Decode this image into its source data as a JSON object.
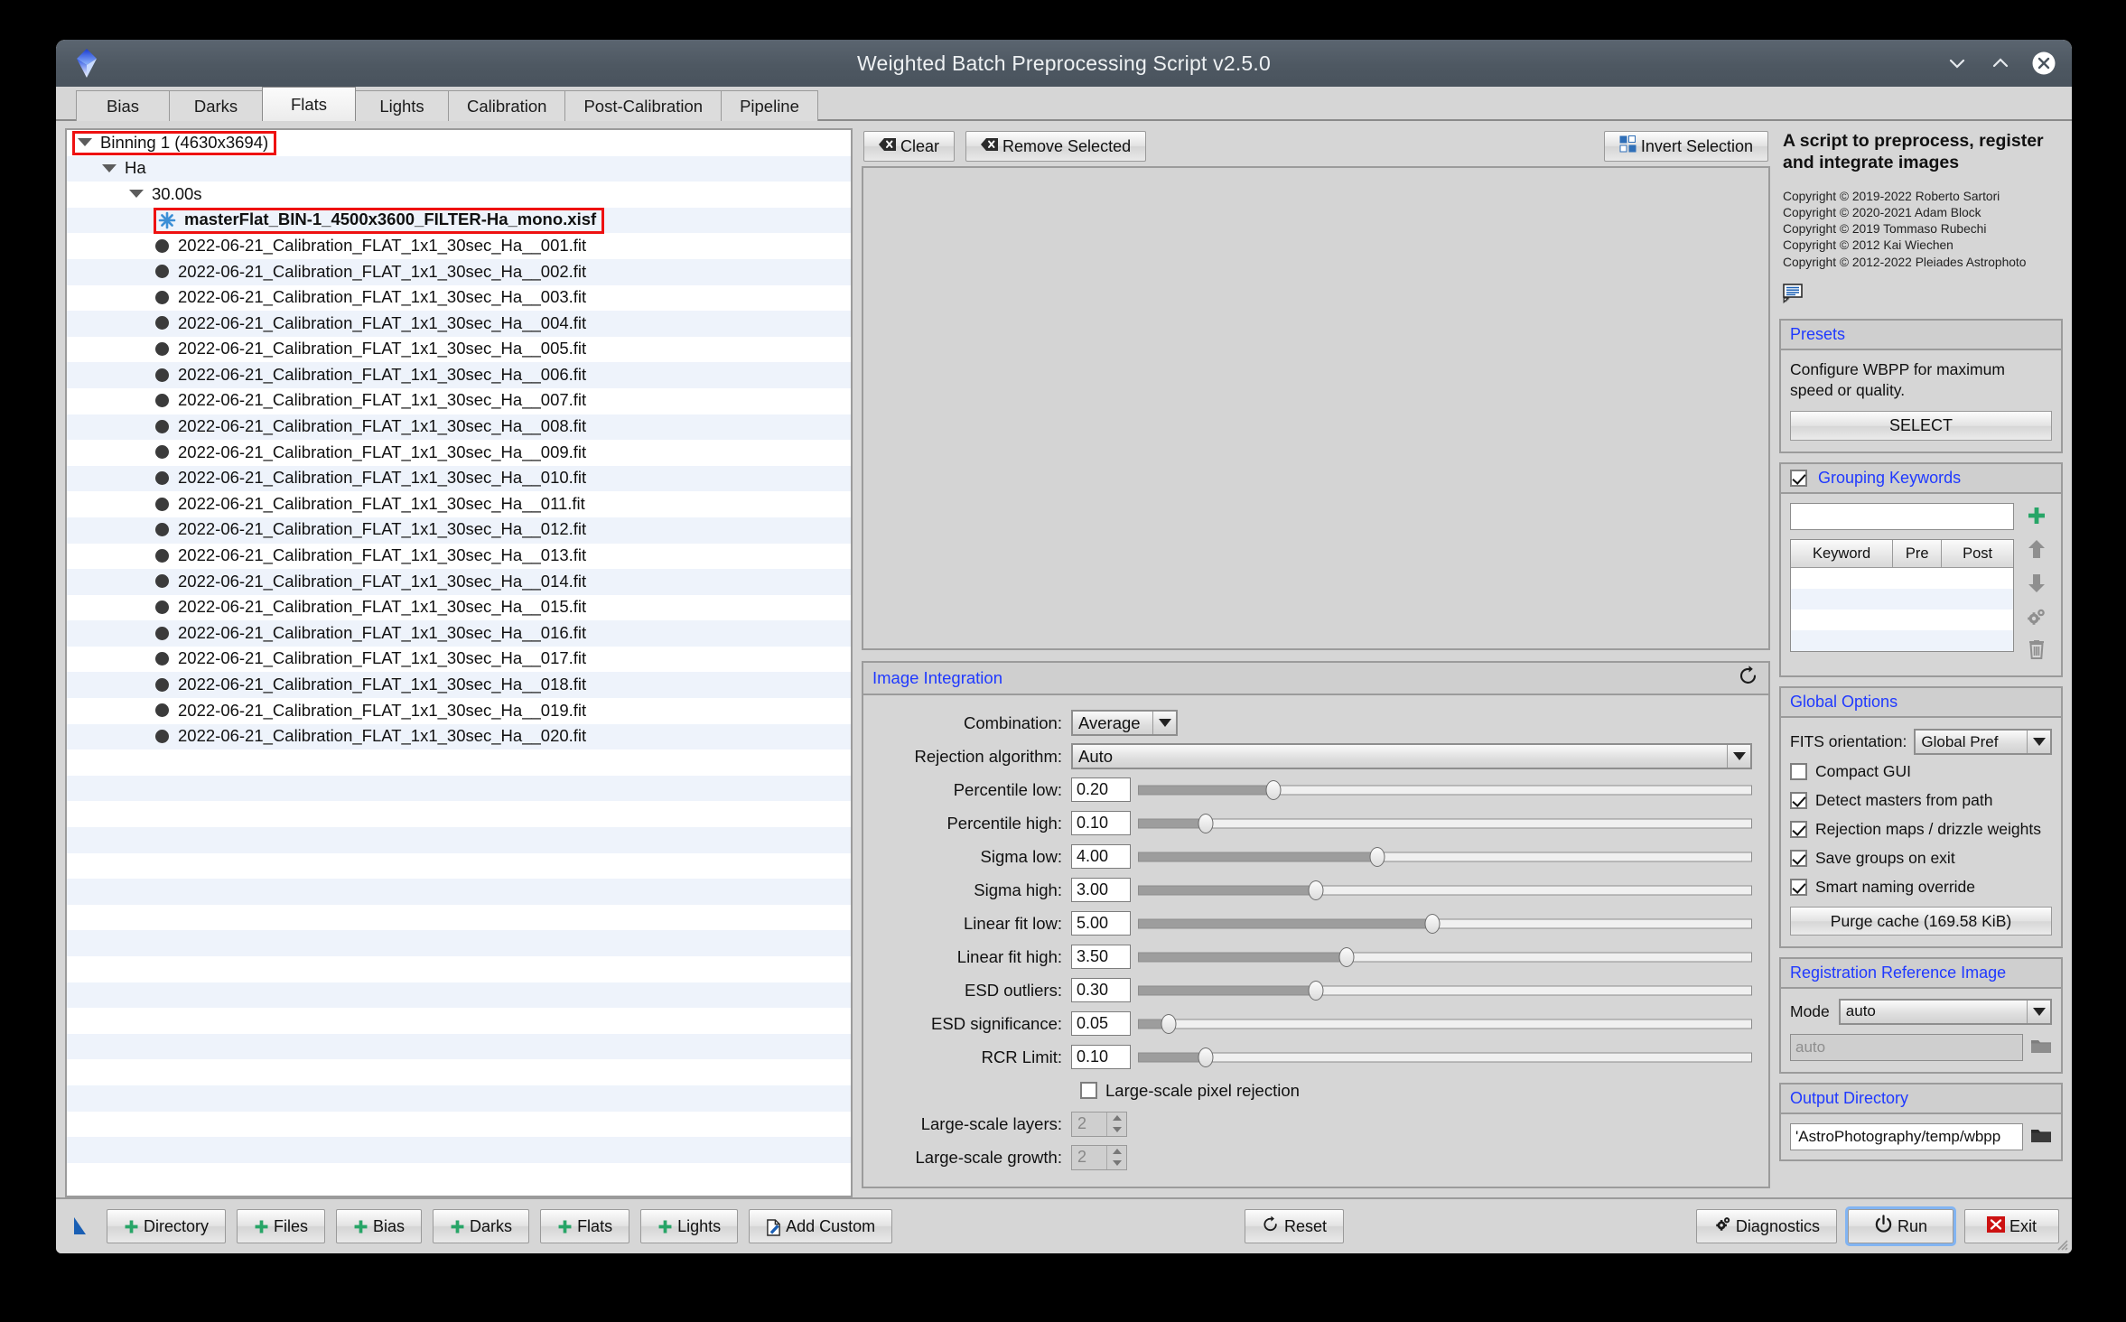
{
  "window": {
    "title": "Weighted Batch Preprocessing Script v2.5.0",
    "minimize_icon": "chevron-down-icon",
    "maximize_icon": "chevron-up-icon",
    "close_icon": "close-icon"
  },
  "tabs": [
    {
      "label": "Bias",
      "active": false
    },
    {
      "label": "Darks",
      "active": false
    },
    {
      "label": "Flats",
      "active": true
    },
    {
      "label": "Lights",
      "active": false
    },
    {
      "label": "Calibration",
      "active": false
    },
    {
      "label": "Post-Calibration",
      "active": false
    },
    {
      "label": "Pipeline",
      "active": false
    }
  ],
  "tree": {
    "rows": [
      {
        "label": "Binning 1 (4630x3694)",
        "indent": 0,
        "icon": "caret-down-icon",
        "highlight": true,
        "bold": false,
        "alt": false
      },
      {
        "label": "Ha",
        "indent": 1,
        "icon": "caret-down-icon",
        "highlight": false,
        "bold": false,
        "alt": true
      },
      {
        "label": "30.00s",
        "indent": 2,
        "icon": "caret-down-icon",
        "highlight": false,
        "bold": false,
        "alt": false
      },
      {
        "label": "masterFlat_BIN-1_4500x3600_FILTER-Ha_mono.xisf",
        "indent": 3,
        "icon": "star-icon",
        "highlight": true,
        "bold": true,
        "alt": true
      },
      {
        "label": "2022-06-21_Calibration_FLAT_1x1_30sec_Ha__001.fit",
        "indent": 3,
        "icon": "dot-icon",
        "highlight": false,
        "bold": false,
        "alt": false
      },
      {
        "label": "2022-06-21_Calibration_FLAT_1x1_30sec_Ha__002.fit",
        "indent": 3,
        "icon": "dot-icon",
        "highlight": false,
        "bold": false,
        "alt": true
      },
      {
        "label": "2022-06-21_Calibration_FLAT_1x1_30sec_Ha__003.fit",
        "indent": 3,
        "icon": "dot-icon",
        "highlight": false,
        "bold": false,
        "alt": false
      },
      {
        "label": "2022-06-21_Calibration_FLAT_1x1_30sec_Ha__004.fit",
        "indent": 3,
        "icon": "dot-icon",
        "highlight": false,
        "bold": false,
        "alt": true
      },
      {
        "label": "2022-06-21_Calibration_FLAT_1x1_30sec_Ha__005.fit",
        "indent": 3,
        "icon": "dot-icon",
        "highlight": false,
        "bold": false,
        "alt": false
      },
      {
        "label": "2022-06-21_Calibration_FLAT_1x1_30sec_Ha__006.fit",
        "indent": 3,
        "icon": "dot-icon",
        "highlight": false,
        "bold": false,
        "alt": true
      },
      {
        "label": "2022-06-21_Calibration_FLAT_1x1_30sec_Ha__007.fit",
        "indent": 3,
        "icon": "dot-icon",
        "highlight": false,
        "bold": false,
        "alt": false
      },
      {
        "label": "2022-06-21_Calibration_FLAT_1x1_30sec_Ha__008.fit",
        "indent": 3,
        "icon": "dot-icon",
        "highlight": false,
        "bold": false,
        "alt": true
      },
      {
        "label": "2022-06-21_Calibration_FLAT_1x1_30sec_Ha__009.fit",
        "indent": 3,
        "icon": "dot-icon",
        "highlight": false,
        "bold": false,
        "alt": false
      },
      {
        "label": "2022-06-21_Calibration_FLAT_1x1_30sec_Ha__010.fit",
        "indent": 3,
        "icon": "dot-icon",
        "highlight": false,
        "bold": false,
        "alt": true
      },
      {
        "label": "2022-06-21_Calibration_FLAT_1x1_30sec_Ha__011.fit",
        "indent": 3,
        "icon": "dot-icon",
        "highlight": false,
        "bold": false,
        "alt": false
      },
      {
        "label": "2022-06-21_Calibration_FLAT_1x1_30sec_Ha__012.fit",
        "indent": 3,
        "icon": "dot-icon",
        "highlight": false,
        "bold": false,
        "alt": true
      },
      {
        "label": "2022-06-21_Calibration_FLAT_1x1_30sec_Ha__013.fit",
        "indent": 3,
        "icon": "dot-icon",
        "highlight": false,
        "bold": false,
        "alt": false
      },
      {
        "label": "2022-06-21_Calibration_FLAT_1x1_30sec_Ha__014.fit",
        "indent": 3,
        "icon": "dot-icon",
        "highlight": false,
        "bold": false,
        "alt": true
      },
      {
        "label": "2022-06-21_Calibration_FLAT_1x1_30sec_Ha__015.fit",
        "indent": 3,
        "icon": "dot-icon",
        "highlight": false,
        "bold": false,
        "alt": false
      },
      {
        "label": "2022-06-21_Calibration_FLAT_1x1_30sec_Ha__016.fit",
        "indent": 3,
        "icon": "dot-icon",
        "highlight": false,
        "bold": false,
        "alt": true
      },
      {
        "label": "2022-06-21_Calibration_FLAT_1x1_30sec_Ha__017.fit",
        "indent": 3,
        "icon": "dot-icon",
        "highlight": false,
        "bold": false,
        "alt": false
      },
      {
        "label": "2022-06-21_Calibration_FLAT_1x1_30sec_Ha__018.fit",
        "indent": 3,
        "icon": "dot-icon",
        "highlight": false,
        "bold": false,
        "alt": true
      },
      {
        "label": "2022-06-21_Calibration_FLAT_1x1_30sec_Ha__019.fit",
        "indent": 3,
        "icon": "dot-icon",
        "highlight": false,
        "bold": false,
        "alt": false
      },
      {
        "label": "2022-06-21_Calibration_FLAT_1x1_30sec_Ha__020.fit",
        "indent": 3,
        "icon": "dot-icon",
        "highlight": false,
        "bold": false,
        "alt": true
      }
    ],
    "empty_rows": 16
  },
  "list_actions": {
    "clear": "Clear",
    "remove_selected": "Remove Selected",
    "invert_selection": "Invert Selection"
  },
  "image_integration": {
    "title": "Image Integration",
    "reset_icon": "reset-icon",
    "combination_label": "Combination:",
    "combination_value": "Average",
    "rejection_label": "Rejection algorithm:",
    "rejection_value": "Auto",
    "sliders": [
      {
        "label": "Percentile low:",
        "value": "0.20",
        "pct": 22
      },
      {
        "label": "Percentile high:",
        "value": "0.10",
        "pct": 11
      },
      {
        "label": "Sigma low:",
        "value": "4.00",
        "pct": 39
      },
      {
        "label": "Sigma high:",
        "value": "3.00",
        "pct": 29
      },
      {
        "label": "Linear fit low:",
        "value": "5.00",
        "pct": 48
      },
      {
        "label": "Linear fit high:",
        "value": "3.50",
        "pct": 34
      },
      {
        "label": "ESD outliers:",
        "value": "0.30",
        "pct": 29
      },
      {
        "label": "ESD significance:",
        "value": "0.05",
        "pct": 5
      },
      {
        "label": "RCR Limit:",
        "value": "0.10",
        "pct": 11
      }
    ],
    "large_scale_rejection_label": "Large-scale pixel rejection",
    "large_scale_rejection_checked": false,
    "large_scale_layers_label": "Large-scale layers:",
    "large_scale_layers_value": "2",
    "large_scale_growth_label": "Large-scale growth:",
    "large_scale_growth_value": "2"
  },
  "info": {
    "headline": "A script to preprocess, register and integrate images",
    "copyright": [
      "Copyright © 2019-2022 Roberto Sartori",
      "Copyright © 2020-2021 Adam Block",
      "Copyright © 2019 Tommaso Rubechi",
      "Copyright © 2012 Kai Wiechen",
      "Copyright © 2012-2022 Pleiades Astrophoto"
    ],
    "doc_icon": "documentation-icon"
  },
  "presets": {
    "title": "Presets",
    "description": "Configure WBPP for maximum speed or quality.",
    "select_label": "SELECT"
  },
  "grouping_keywords": {
    "title": "Grouping Keywords",
    "enabled": true,
    "input_value": "",
    "columns": [
      "Keyword",
      "Pre",
      "Post"
    ],
    "rows": [],
    "tools": [
      "plus-icon",
      "move-up-icon",
      "move-down-icon",
      "settings-icon",
      "delete-icon"
    ]
  },
  "global_options": {
    "title": "Global Options",
    "fits_orientation_label": "FITS orientation:",
    "fits_orientation_value": "Global Pref",
    "checkboxes": [
      {
        "label": "Compact GUI",
        "checked": false
      },
      {
        "label": "Detect masters from path",
        "checked": true
      },
      {
        "label": "Rejection maps / drizzle weights",
        "checked": true
      },
      {
        "label": "Save groups on exit",
        "checked": true
      },
      {
        "label": "Smart naming override",
        "checked": true
      }
    ],
    "purge_cache_label": "Purge cache (169.58 KiB)"
  },
  "registration_reference": {
    "title": "Registration Reference Image",
    "mode_label": "Mode",
    "mode_value": "auto",
    "path_placeholder": "auto",
    "folder_icon": "folder-icon"
  },
  "output_directory": {
    "title": "Output Directory",
    "path_value": "'AstroPhotography/temp/wbpp",
    "folder_icon": "folder-icon"
  },
  "bottom_toolbar": {
    "drag_icon": "drag-cursor-icon",
    "left_buttons": [
      {
        "label": "Directory",
        "icon": "plus-icon"
      },
      {
        "label": "Files",
        "icon": "plus-icon"
      },
      {
        "label": "Bias",
        "icon": "plus-icon"
      },
      {
        "label": "Darks",
        "icon": "plus-icon"
      },
      {
        "label": "Flats",
        "icon": "plus-icon"
      },
      {
        "label": "Lights",
        "icon": "plus-icon"
      },
      {
        "label": "Add Custom",
        "icon": "document-add-icon"
      }
    ],
    "reset_label": "Reset",
    "diagnostics_label": "Diagnostics",
    "run_label": "Run",
    "exit_label": "Exit"
  },
  "colors": {
    "accent_blue": "#1f39ff",
    "highlight_red": "#ee1111",
    "green_plus": "#27a567",
    "exit_red": "#cc1111",
    "titlebar": "#4e5862"
  }
}
